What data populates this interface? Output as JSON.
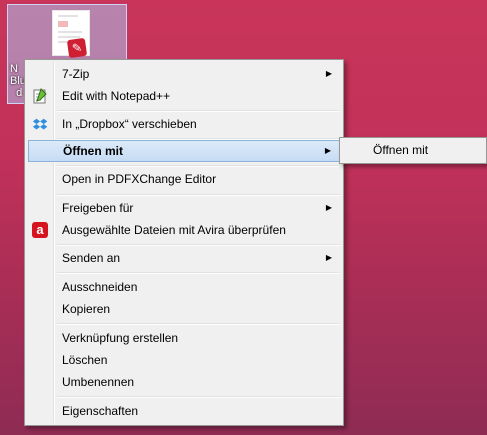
{
  "desktop": {
    "icon_label": "N\nBlu\nd",
    "pdf_badge_icon": "pdf-file-icon"
  },
  "menu": {
    "items": [
      {
        "label": "7-Zip",
        "submenu": true,
        "icon": ""
      },
      {
        "label": "Edit with Notepad++",
        "submenu": false,
        "icon": "notepadpp-icon"
      },
      {
        "label": "In „Dropbox“ verschieben",
        "submenu": false,
        "icon": "dropbox-icon"
      },
      {
        "label": "Öffnen mit",
        "submenu": true,
        "icon": "",
        "highlighted": true
      },
      {
        "label": "Open in PDFXChange Editor",
        "submenu": false,
        "icon": ""
      },
      {
        "label": "Freigeben für",
        "submenu": true,
        "icon": ""
      },
      {
        "label": "Ausgewählte Dateien mit Avira überprüfen",
        "submenu": false,
        "icon": "avira-icon"
      },
      {
        "label": "Senden an",
        "submenu": true,
        "icon": ""
      },
      {
        "label": "Ausschneiden",
        "submenu": false,
        "icon": ""
      },
      {
        "label": "Kopieren",
        "submenu": false,
        "icon": ""
      },
      {
        "label": "Verknüpfung erstellen",
        "submenu": false,
        "icon": ""
      },
      {
        "label": "Löschen",
        "submenu": false,
        "icon": ""
      },
      {
        "label": "Umbenennen",
        "submenu": false,
        "icon": ""
      },
      {
        "label": "Eigenschaften",
        "submenu": false,
        "icon": ""
      }
    ]
  },
  "submenu": {
    "items": [
      {
        "label": "Öffnen mit"
      }
    ]
  },
  "colors": {
    "highlight": "#c6dcf4",
    "menu_bg": "#f0f0f0",
    "avira": "#d6141f"
  }
}
